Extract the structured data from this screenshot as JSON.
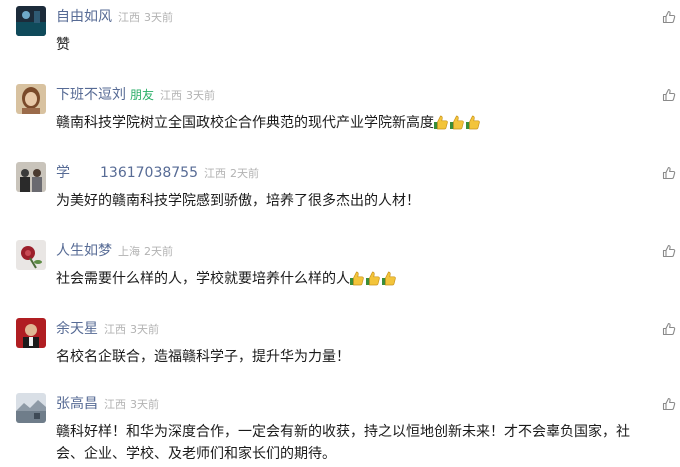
{
  "comments": [
    {
      "name": "自由如风",
      "friend": "",
      "phone": "",
      "location": "江西",
      "time": "3天前",
      "text": "赞",
      "thumbs": 0,
      "avatar": "landscape-dark-avatar"
    },
    {
      "name": "下班不逗刘",
      "friend": "朋友",
      "phone": "",
      "location": "江西",
      "time": "3天前",
      "text": "赣南科技学院树立全国政校企合作典范的现代产业学院新高度",
      "thumbs": 3,
      "avatar": "portrait-avatar"
    },
    {
      "name": "学",
      "friend": "",
      "phone": "13617038755",
      "location": "江西",
      "time": "2天前",
      "text": "为美好的赣南科技学院感到骄傲，培养了很多杰出的人材！",
      "thumbs": 0,
      "avatar": "group-photo-avatar"
    },
    {
      "name": "人生如梦",
      "friend": "",
      "phone": "",
      "location": "上海",
      "time": "2天前",
      "text": "社会需要什么样的人，学校就要培养什么样的人",
      "thumbs": 3,
      "avatar": "flower-avatar"
    },
    {
      "name": "余天星",
      "friend": "",
      "phone": "",
      "location": "江西",
      "time": "3天前",
      "text": "名校名企联合，造福赣科学子，提升华为力量！",
      "thumbs": 0,
      "avatar": "red-portrait-avatar"
    },
    {
      "name": "张高昌",
      "friend": "",
      "phone": "",
      "location": "江西",
      "time": "3天前",
      "text": "赣科好样！和华为深度合作，一定会有新的收获，持之以恒地创新未来！才不会辜负国家，社会、企业、学校、及老师们和家长们的期待。",
      "thumbs": 0,
      "avatar": "scenery-avatar"
    }
  ],
  "colors": {
    "name": "#576b95",
    "friend": "#2aae67",
    "meta": "#b2b2b2",
    "text": "#1a1a1a"
  },
  "icons": {
    "like": "thumbs-up-outline-icon",
    "emoji": "thumbs-up-emoji-icon"
  }
}
